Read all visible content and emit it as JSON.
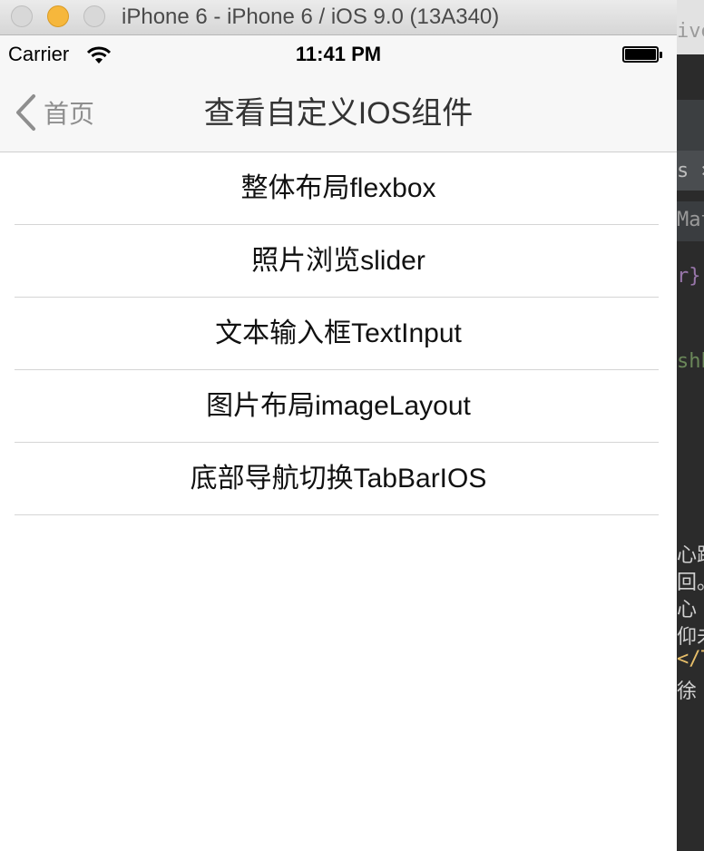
{
  "window": {
    "title": "iPhone 6 - iPhone 6 / iOS 9.0 (13A340)",
    "controls": [
      "close",
      "minimize",
      "zoom"
    ]
  },
  "statusbar": {
    "carrier": "Carrier",
    "time": "11:41 PM",
    "wifi_icon": "wifi-icon",
    "battery_icon": "battery-icon"
  },
  "navbar": {
    "back_label": "首页",
    "back_icon": "chevron-left-icon",
    "title": "查看自定义IOS组件"
  },
  "list": {
    "items": [
      {
        "label": "整体布局flexbox"
      },
      {
        "label": "照片浏览slider"
      },
      {
        "label": "文本输入框TextInput"
      },
      {
        "label": "图片布局imageLayout"
      },
      {
        "label": "底部导航切换TabBarIOS"
      }
    ]
  },
  "background_editor": {
    "fragments": [
      "ive",
      "s ×",
      "Mat",
      "r}",
      "shh",
      "心跳",
      "回。",
      "心",
      "仰未",
      "</T",
      "徐"
    ]
  },
  "colors": {
    "accent_minimize": "#f6b73c",
    "nav_background": "#f7f7f7",
    "editor_background": "#2b2b2b"
  }
}
